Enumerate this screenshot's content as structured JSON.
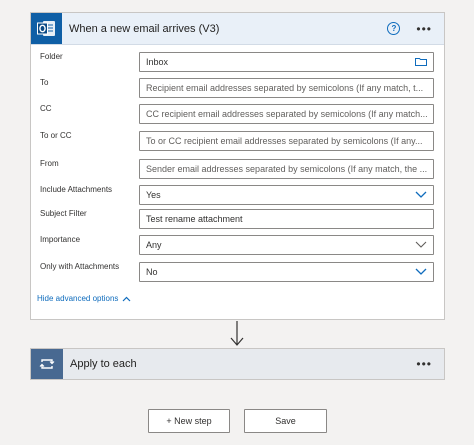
{
  "trigger": {
    "title": "When a new email arrives (V3)",
    "icon": "outlook-icon",
    "fields": {
      "folder": {
        "label": "Folder",
        "value": "Inbox"
      },
      "to": {
        "label": "To",
        "placeholder": "Recipient email addresses separated by semicolons (If any match, t..."
      },
      "cc": {
        "label": "CC",
        "placeholder": "CC recipient email addresses separated by semicolons (If any match..."
      },
      "to_or_cc": {
        "label": "To or CC",
        "placeholder": "To or CC recipient email addresses separated by semicolons (If any..."
      },
      "from": {
        "label": "From",
        "placeholder": "Sender email addresses separated by semicolons (If any match, the ..."
      },
      "include_attachments": {
        "label": "Include Attachments",
        "value": "Yes"
      },
      "subject_filter": {
        "label": "Subject Filter",
        "value": "Test rename attachment"
      },
      "importance": {
        "label": "Importance",
        "value": "Any"
      },
      "only_with_attachments": {
        "label": "Only with Attachments",
        "value": "No"
      }
    },
    "advanced_toggle": "Hide advanced options"
  },
  "apply": {
    "title": "Apply to each",
    "icon": "loop-icon"
  },
  "buttons": {
    "new_step": "+ New step",
    "save": "Save"
  },
  "colors": {
    "trigger_header_bg": "#e9f0f8",
    "outlook_blue": "#0f5fa6",
    "loop_blue": "#486991",
    "link_blue": "#0f6cbd"
  }
}
